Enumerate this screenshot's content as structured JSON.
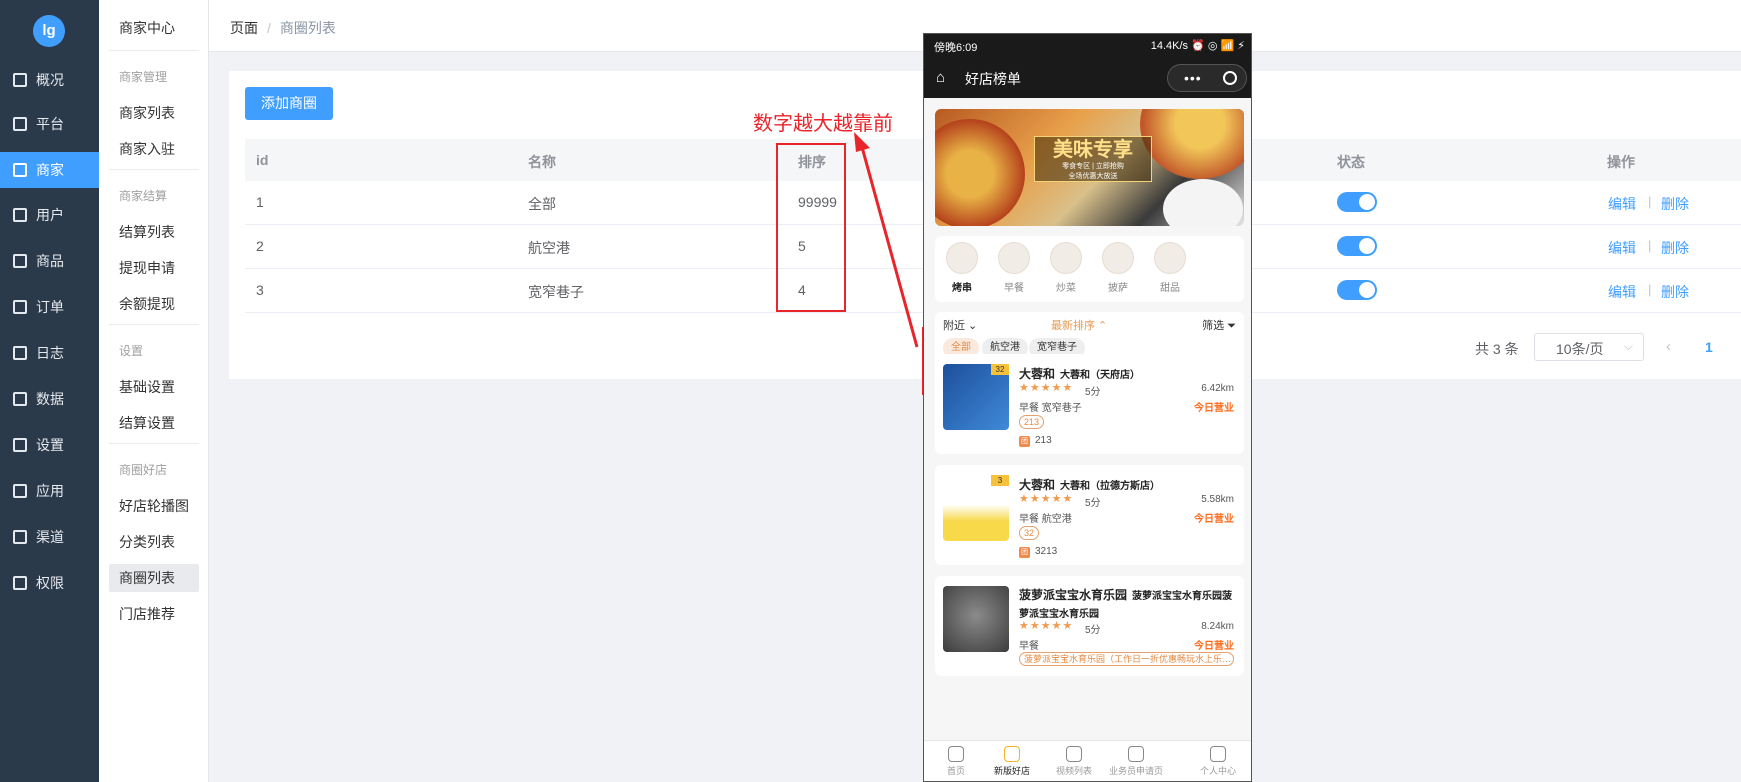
{
  "sidebar": {
    "logo": "lg",
    "items": [
      {
        "label": "概况",
        "icon": "chart-icon"
      },
      {
        "label": "平台",
        "icon": "monitor-icon"
      },
      {
        "label": "商家",
        "icon": "shop-icon"
      },
      {
        "label": "用户",
        "icon": "user-icon"
      },
      {
        "label": "商品",
        "icon": "goods-icon"
      },
      {
        "label": "订单",
        "icon": "order-icon"
      },
      {
        "label": "日志",
        "icon": "log-icon"
      },
      {
        "label": "数据",
        "icon": "data-icon"
      },
      {
        "label": "设置",
        "icon": "gear-icon"
      },
      {
        "label": "应用",
        "icon": "apps-icon"
      },
      {
        "label": "渠道",
        "icon": "channel-icon"
      },
      {
        "label": "权限",
        "icon": "lock-icon"
      }
    ],
    "active_index": 2
  },
  "submenu": {
    "title": "商家中心",
    "groups": [
      "商家管理",
      "商家结算",
      "设置",
      "商圈好店"
    ],
    "items": [
      "商家列表",
      "商家入驻",
      "结算列表",
      "提现申请",
      "余额提现",
      "基础设置",
      "结算设置",
      "好店轮播图",
      "分类列表",
      "商圈列表",
      "门店推荐"
    ],
    "active": "商圈列表"
  },
  "breadcrumb": {
    "root": "页面",
    "sep": "/",
    "current": "商圈列表"
  },
  "toolbar": {
    "add_label": "添加商圈"
  },
  "table": {
    "headers": {
      "id": "id",
      "name": "名称",
      "sort": "排序",
      "status": "状态",
      "ops": "操作"
    },
    "rows": [
      {
        "id": "1",
        "name": "全部",
        "sort": "99999",
        "status": true
      },
      {
        "id": "2",
        "name": "航空港",
        "sort": "5",
        "status": true
      },
      {
        "id": "3",
        "name": "宽窄巷子",
        "sort": "4",
        "status": true
      }
    ],
    "edit_label": "编辑",
    "delete_label": "删除",
    "op_sep": "|"
  },
  "pager": {
    "total": "共 3 条",
    "size": "10条/页",
    "prev": "‹",
    "current": "1"
  },
  "annotation": {
    "text": "数字越大越靠前",
    "color": "#e8252b"
  },
  "phone": {
    "status_time": "傍晚6:09",
    "status_right": "14.4K/s ⏰ ◎ 📶 ⚡",
    "nav_title": "好店榜单",
    "nav_dots": "•••",
    "banner_title": "美味专享",
    "banner_sub": "零食专区 | 立即抢购",
    "banner_sub2": "全场优惠大放送",
    "categories": [
      "烤串",
      "早餐",
      "炒菜",
      "披萨",
      "甜品"
    ],
    "filter_near": "附近 ⌄",
    "filter_sort": "最新排序 ⌃",
    "filter_select": "筛选 ⏷",
    "chips": [
      "全部",
      "航空港",
      "宽窄巷子"
    ],
    "shops": [
      {
        "badge": "32",
        "name": "大蓉和",
        "branch": "大蓉和（天府店）",
        "stars": "★★★★★",
        "score": "5分",
        "dist": "6.42km",
        "tags": "早餐    宽窄巷子",
        "open": "今日营业",
        "num": "213",
        "buy": "213"
      },
      {
        "badge": "3",
        "name": "大蓉和",
        "branch": "大蓉和（拉德方斯店）",
        "stars": "★★★★★",
        "score": "5分",
        "dist": "5.58km",
        "tags": "早餐    航空港",
        "open": "今日营业",
        "num": "32",
        "buy": "3213"
      },
      {
        "name": "菠萝派宝宝水育乐园",
        "branch": "菠萝派宝宝水育乐园菠萝派宝宝水育乐园",
        "stars": "★★★★★",
        "score": "5分",
        "dist": "8.24km",
        "tags": "早餐",
        "open": "今日营业",
        "num": "菠萝派宝宝水育乐园（工作日一折优惠畅玩水上乐…"
      }
    ],
    "buy_icon": "团",
    "tabs": [
      "首页",
      "新版好店",
      "视频列表",
      "业务员申请页",
      "个人中心"
    ],
    "active_tab": "新版好店"
  }
}
